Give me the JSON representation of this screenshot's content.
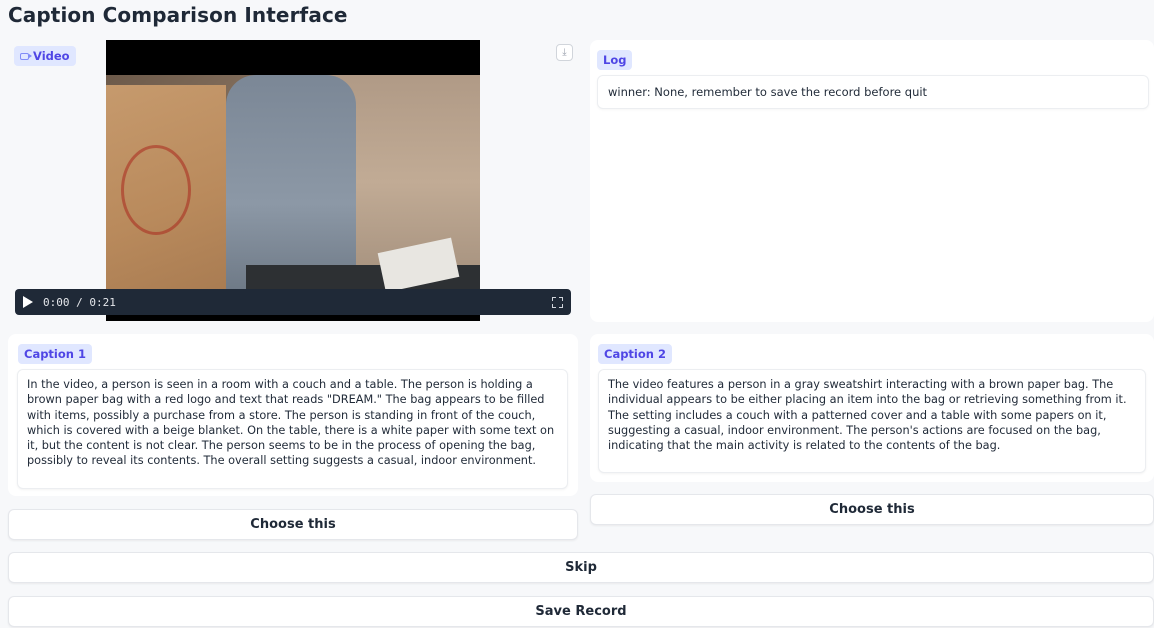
{
  "header": {
    "title": "Caption Comparison Interface"
  },
  "video": {
    "label": "Video",
    "label_icon": "video-camera-icon",
    "time": "0:00 / 0:21",
    "controls": {
      "play_icon": "play-icon",
      "fullscreen_icon": "fullscreen-icon",
      "download_icon": "download-icon",
      "download_glyph": "⤓"
    }
  },
  "log": {
    "label": "Log",
    "value": "winner: None, remember to save the record before quit"
  },
  "caption1": {
    "label": "Caption 1",
    "text": "In the video, a person is seen in a room with a couch and a table. The person is holding a brown paper bag with a red logo and text that reads \"DREAM.\" The bag appears to be filled with items, possibly a purchase from a store. The person is standing in front of the couch, which is covered with a beige blanket. On the table, there is a white paper with some text on it, but the content is not clear. The person seems to be in the process of opening the bag, possibly to reveal its contents. The overall setting suggests a casual, indoor environment."
  },
  "caption2": {
    "label": "Caption 2",
    "text": "The video features a person in a gray sweatshirt interacting with a brown paper bag. The individual appears to be either placing an item into the bag or retrieving something from it. The setting includes a couch with a patterned cover and a table with some papers on it, suggesting a casual, indoor environment. The person's actions are focused on the bag, indicating that the main activity is related to the contents of the bag."
  },
  "buttons": {
    "choose1": "Choose this",
    "choose2": "Choose this",
    "skip": "Skip",
    "save": "Save Record"
  },
  "colors": {
    "background": "#f7f8fa",
    "chip_bg": "#e0e7ff",
    "chip_text": "#4f46e5",
    "video_controls": "#1f2937"
  }
}
